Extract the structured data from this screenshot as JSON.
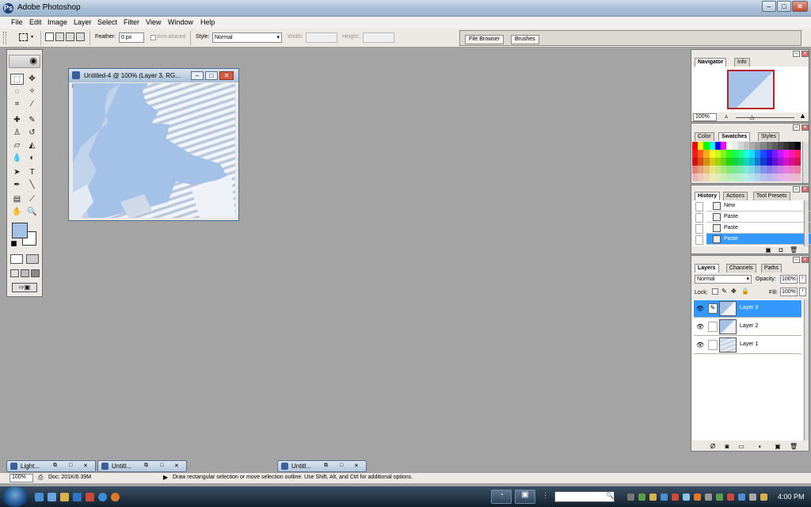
{
  "window": {
    "title": "Adobe Photoshop"
  },
  "menu": [
    "File",
    "Edit",
    "Image",
    "Layer",
    "Select",
    "Filter",
    "View",
    "Window",
    "Help"
  ],
  "options": {
    "feather_label": "Feather:",
    "feather_value": "0 px",
    "antialias_label": "Anti-aliased",
    "style_label": "Style:",
    "style_value": "Normal",
    "width_label": "Width:",
    "height_label": "Height:"
  },
  "palette_well": {
    "tabs": [
      "File Browser",
      "Brushes"
    ]
  },
  "document": {
    "title": "Untitled-4 @ 100% (Layer 3, RG...",
    "canvas_color": "#a4c2e8"
  },
  "navigator": {
    "tabs": [
      "Navigator",
      "Info"
    ],
    "zoom": "100%"
  },
  "swatches": {
    "tabs": [
      "Color",
      "Swatches",
      "Styles"
    ]
  },
  "history": {
    "tabs": [
      "History",
      "Actions",
      "Tool Presets"
    ],
    "items": [
      "New",
      "Paste",
      "Paste",
      "Paste"
    ]
  },
  "layers": {
    "tabs": [
      "Layers",
      "Channels",
      "Paths"
    ],
    "blend_mode": "Normal",
    "opacity_label": "Opacity:",
    "opacity_value": "100%",
    "lock_label": "Lock:",
    "fill_label": "Fill:",
    "fill_value": "100%",
    "items": [
      "Layer 3",
      "Layer 2",
      "Layer 1"
    ]
  },
  "minimized": [
    "Light...",
    "Untitl...",
    "Untitl..."
  ],
  "status": {
    "zoom": "100%",
    "doc": "Doc: 201K/6.39M",
    "hint": "Draw rectangular selection or move selection outline. Use Shift, Alt, and Ctrl for additional options."
  },
  "taskbar": {
    "clock": "4:00 PM"
  },
  "colors": {
    "accent": "#3399ff",
    "foreground": "#a4c2e8",
    "background": "#ffffff"
  }
}
